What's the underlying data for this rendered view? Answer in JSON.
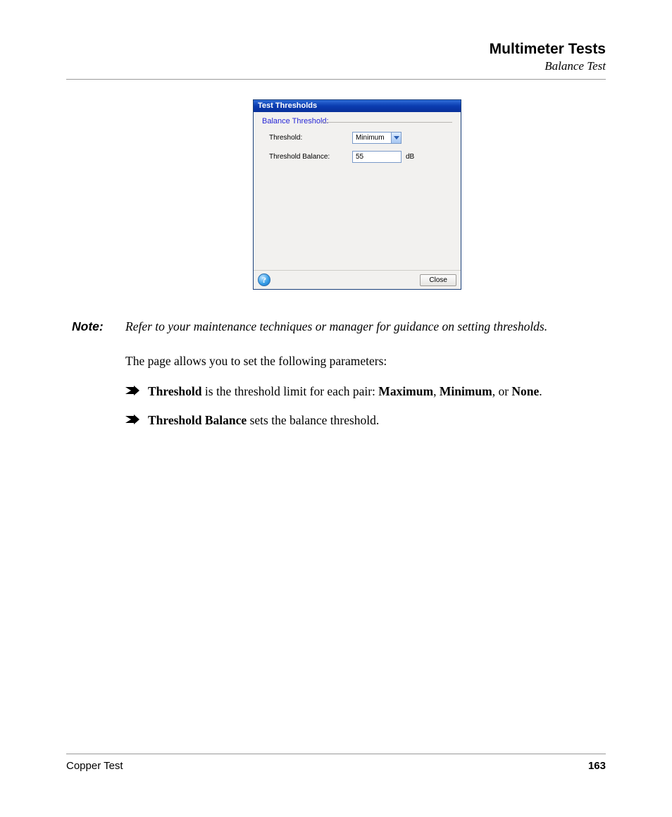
{
  "header": {
    "title": "Multimeter Tests",
    "subtitle": "Balance Test"
  },
  "dialog": {
    "title": "Test Thresholds",
    "group_legend": "Balance Threshold:",
    "rows": {
      "threshold": {
        "label": "Threshold:",
        "value": "Minimum"
      },
      "threshold_balance": {
        "label": "Threshold Balance:",
        "value": "55",
        "unit": "dB"
      }
    },
    "help_glyph": "?",
    "close_label": "Close"
  },
  "note": {
    "label": "Note:",
    "text": "Refer to your maintenance techniques or manager for guidance on setting thresholds."
  },
  "intro": "The page allows you to set the following parameters:",
  "bullets": [
    {
      "lead_bold": "Threshold",
      "mid1": " is the threshold limit for each pair: ",
      "opt1": "Maximum",
      "sep1": ", ",
      "opt2": "Minimum",
      "sep2": ", or ",
      "opt3": "None",
      "tail": "."
    },
    {
      "lead_bold": "Threshold Balance",
      "mid1": " sets the balance threshold.",
      "opt1": "",
      "sep1": "",
      "opt2": "",
      "sep2": "",
      "opt3": "",
      "tail": ""
    }
  ],
  "footer": {
    "left": "Copper Test",
    "right": "163"
  }
}
